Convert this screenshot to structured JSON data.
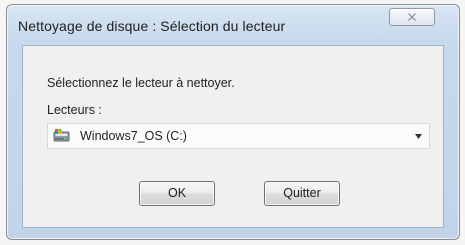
{
  "dialog": {
    "title": "Nettoyage de disque : Sélection du lecteur",
    "instruction": "Sélectionnez le lecteur à nettoyer.",
    "drives_label": "Lecteurs :",
    "selected_drive": "Windows7_OS (C:)",
    "ok_label": "OK",
    "quit_label": "Quitter"
  },
  "icons": {
    "close": "close-icon",
    "drive": "drive-icon",
    "dropdown": "chevron-down-icon"
  }
}
